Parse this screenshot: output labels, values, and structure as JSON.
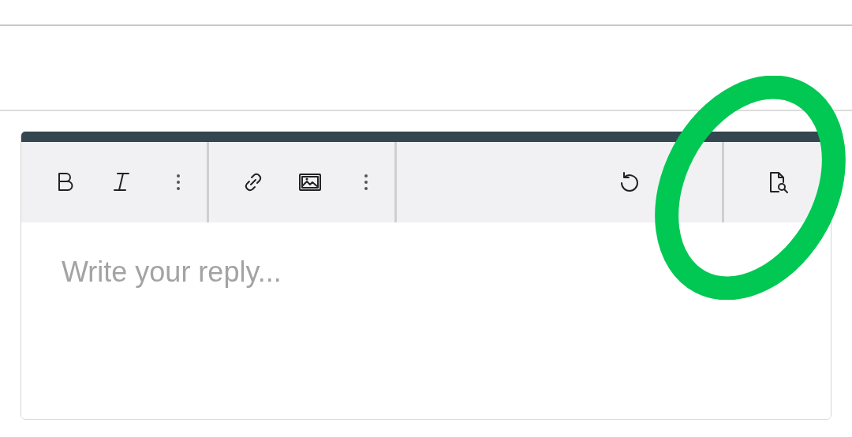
{
  "editor": {
    "placeholder": "Write your reply...",
    "toolbar_groups": [
      {
        "buttons": [
          {
            "kind": "bold"
          },
          {
            "kind": "italic"
          },
          {
            "kind": "more"
          }
        ]
      },
      {
        "buttons": [
          {
            "kind": "link"
          },
          {
            "kind": "image"
          },
          {
            "kind": "more"
          }
        ]
      }
    ],
    "right_buttons": [
      {
        "kind": "undo"
      },
      {
        "kind": "preview"
      }
    ]
  }
}
